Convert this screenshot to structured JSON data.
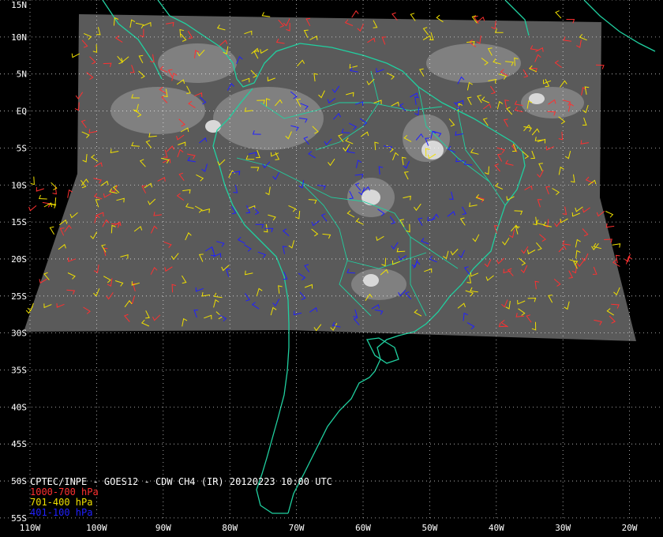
{
  "title": "CPTEC/INPE - GOES12 - CDW CH4 (IR) 20120223 10:00 UTC",
  "legend": [
    {
      "label": "1000-700 hPa",
      "color": "#ff3030"
    },
    {
      "label": "701-400 hPa",
      "color": "#f0e000"
    },
    {
      "label": "401-100 hPa",
      "color": "#2020ff"
    }
  ],
  "colors": {
    "background": "#000000",
    "coastline": "#20d0a0",
    "grid": "#ffffff",
    "imagery": "#5a5a5a"
  },
  "lat_labels": [
    "15N",
    "10N",
    "5N",
    "EQ",
    "5S",
    "10S",
    "15S",
    "20S",
    "25S",
    "30S",
    "35S",
    "40S",
    "45S",
    "50S",
    "55S"
  ],
  "lon_labels": [
    "110W",
    "100W",
    "90W",
    "80W",
    "70W",
    "60W",
    "50W",
    "40W",
    "30W",
    "20W"
  ],
  "extent": {
    "lon": [
      -110,
      -20
    ],
    "lat": [
      -55,
      15
    ]
  }
}
